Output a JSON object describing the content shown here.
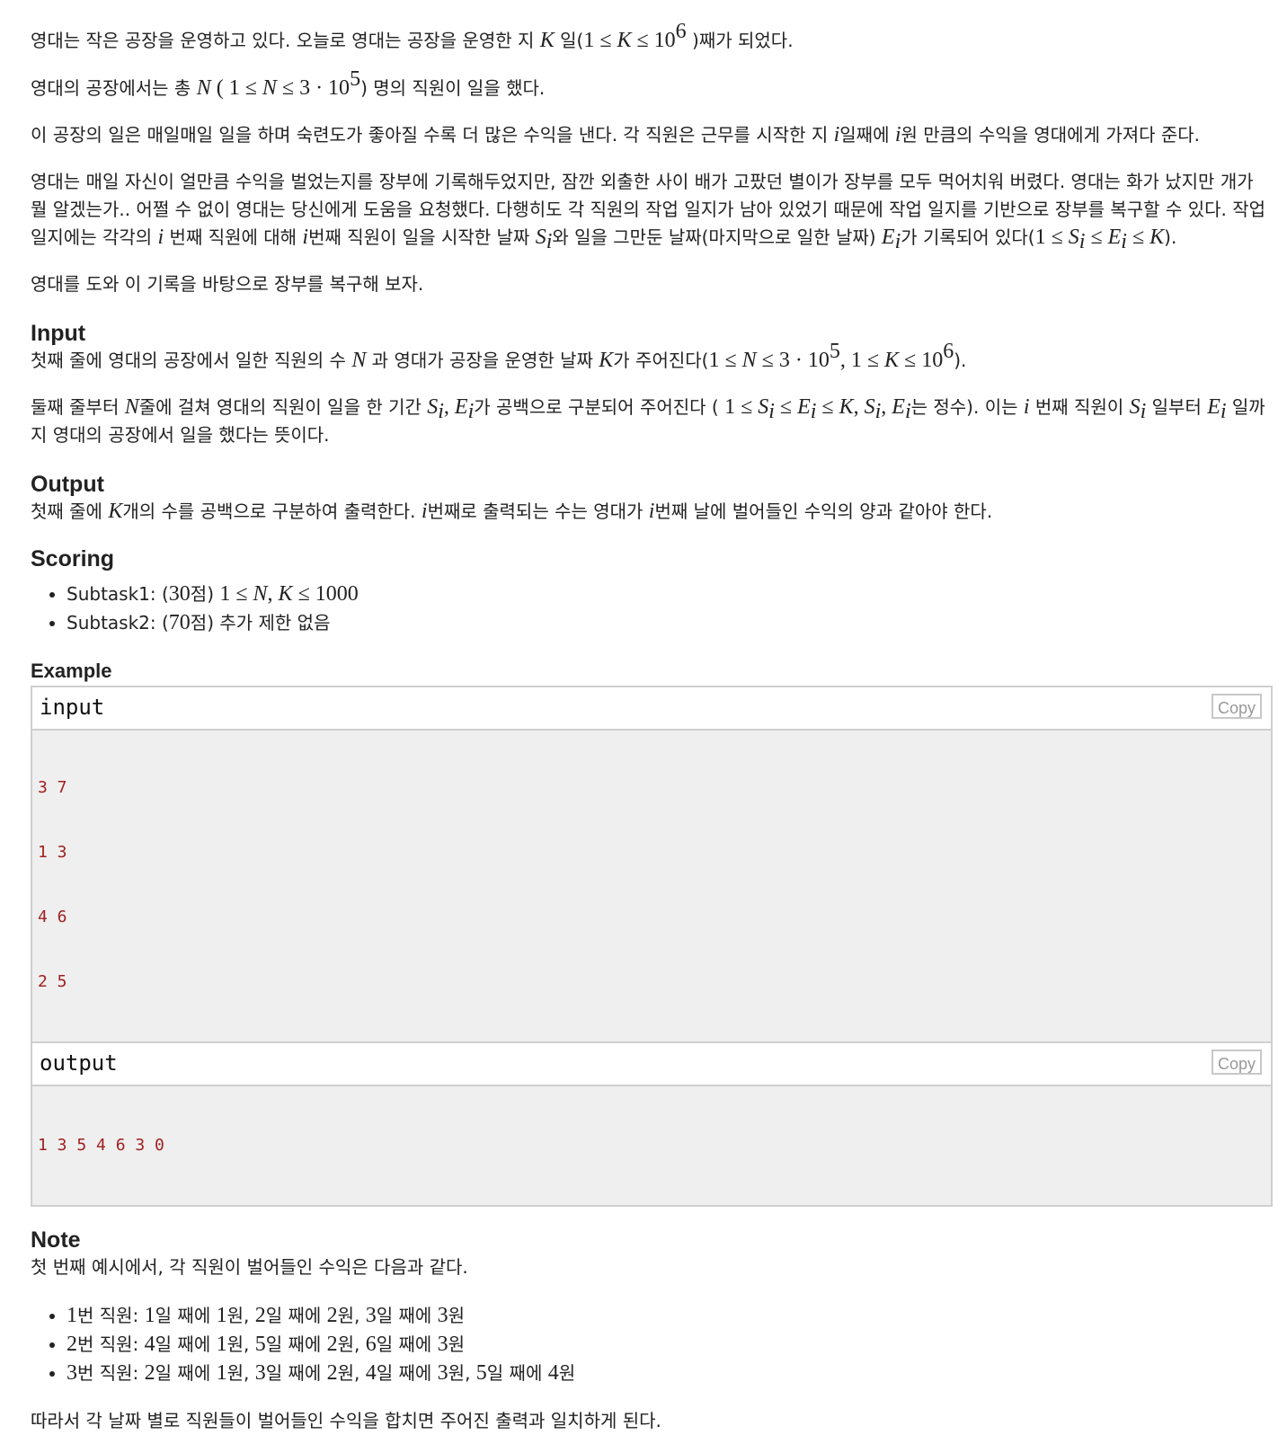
{
  "statement": {
    "p1": [
      "영대는 작은 공장을 운영하고 있다. 오늘로 영대는 공장을 운영한 지 ",
      "K",
      " 일(",
      "1 ≤ ",
      "K",
      " ≤ 10",
      "6",
      " )째가 되었다."
    ],
    "p2": [
      "영대의 공장에서는 총 ",
      "N",
      " ( ",
      "1 ≤ ",
      "N",
      " ≤ 3 · 10",
      "5",
      ") 명의 직원이 일을 했다."
    ],
    "p3": [
      "이 공장의 일은 매일매일 일을 하며 숙련도가 좋아질 수록 더 많은 수익을 낸다. 각 직원은 근무를 시작한 지 ",
      "i",
      "일째에 ",
      "i",
      "원 만큼의 수익을 영대에게 가져다 준다."
    ],
    "p4": [
      "영대는 매일 자신이 얼만큼 수익을 벌었는지를 장부에 기록해두었지만, 잠깐 외출한 사이 배가 고팠던 별이가 장부를 모두 먹어치워 버렸다. 영대는 화가 났지만 개가 뭘 알겠는가.. 어쩔 수 없이 영대는 당신에게 도움을 요청했다. 다행히도 각 직원의 작업 일지가 남아 있었기 때문에 작업 일지를 기반으로 장부를 복구할 수 있다. 작업 일지에는 각각의 ",
      "i",
      " 번째 직원에 대해 ",
      "i",
      "번째 직원이 일을 시작한 날짜 ",
      "S",
      "i",
      "와 일을 그만둔 날짜(마지막으로 일한 날짜) ",
      "E",
      "i",
      "가 기록되어 있다(",
      "1 ≤ ",
      "S",
      "i",
      " ≤ ",
      "E",
      "i",
      " ≤ ",
      "K",
      ")."
    ],
    "p5": "영대를 도와 이 기록을 바탕으로 장부를 복구해 보자."
  },
  "input_section": {
    "title": "Input",
    "p1": [
      "첫째 줄에 영대의 공장에서 일한 직원의 수 ",
      "N",
      " 과 영대가 공장을 운영한 날짜 ",
      "K",
      "가 주어진다(",
      "1 ≤ ",
      "N",
      " ≤ 3 · 10",
      "5",
      ", 1 ≤ ",
      "K",
      " ≤ 10",
      "6",
      ")."
    ],
    "p2": [
      "둘째 줄부터 ",
      "N",
      "줄에 걸쳐 영대의 직원이 일을 한 기간 ",
      "S",
      "i",
      ", ",
      "E",
      "i",
      "가 공백으로 구분되어 주어진다 ( ",
      "1 ≤ ",
      "S",
      "i",
      " ≤ ",
      "E",
      "i",
      " ≤ ",
      "K",
      ", ",
      "S",
      "i",
      ", ",
      "E",
      "i",
      "는 정수). 이는 ",
      "i",
      " 번째 직원이 ",
      "S",
      "i",
      " 일부터 ",
      "E",
      "i",
      " 일까지 영대의 공장에서 일을 했다는 뜻이다."
    ]
  },
  "output_section": {
    "title": "Output",
    "p1": [
      "첫째 줄에 ",
      "K",
      "개의 수를 공백으로 구분하여 출력한다. ",
      "i",
      "번째로 출력되는 수는 영대가 ",
      "i",
      "번째 날에 벌어들인 수익의 양과 같아야 한다."
    ]
  },
  "scoring_section": {
    "title": "Scoring",
    "items": [
      [
        "Subtask1: (",
        "30",
        "점) ",
        "1 ≤ ",
        "N",
        ", ",
        "K",
        " ≤ 1000"
      ],
      [
        "Subtask2: (",
        "70",
        "점) 추가 제한 없음"
      ]
    ]
  },
  "example_section": {
    "title": "Example",
    "copy_label": "Copy",
    "input": {
      "label": "input",
      "lines": [
        "3 7",
        "1 3",
        "4 6",
        "2 5"
      ]
    },
    "output": {
      "label": "output",
      "lines": [
        "1 3 5 4 6 3 0"
      ]
    }
  },
  "note_section": {
    "title": "Note",
    "intro": "첫 번째 예시에서, 각 직원이 벌어들인 수익은 다음과 같다.",
    "items": [
      [
        "1",
        "번 직원: ",
        "1",
        "일 째에 ",
        "1",
        "원, ",
        "2",
        "일 째에 ",
        "2",
        "원, ",
        "3",
        "일 째에 ",
        "3",
        "원"
      ],
      [
        "2",
        "번 직원: ",
        "4",
        "일 째에 ",
        "1",
        "원, ",
        "5",
        "일 째에 ",
        "2",
        "원, ",
        "6",
        "일 째에 ",
        "3",
        "원"
      ],
      [
        "3",
        "번 직원: ",
        "2",
        "일 째에 ",
        "1",
        "원, ",
        "3",
        "일 째에 ",
        "2",
        "원, ",
        "4",
        "일 째에 ",
        "3",
        "원, ",
        "5",
        "일 째에 ",
        "4",
        "원"
      ]
    ],
    "outro": "따라서 각 날짜 별로 직원들이 벌어들인 수익을 합치면 주어진 출력과 일치하게 된다."
  }
}
